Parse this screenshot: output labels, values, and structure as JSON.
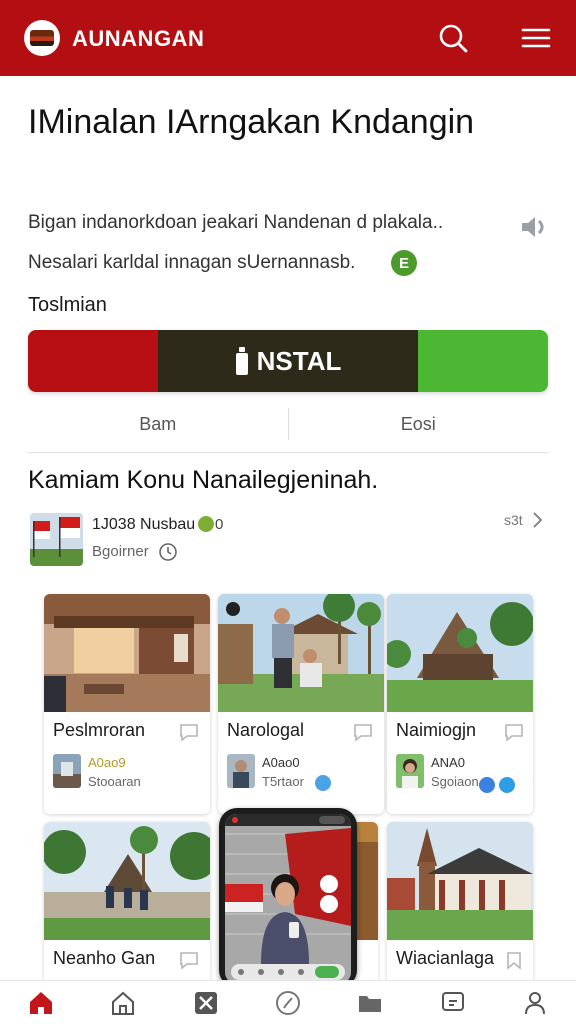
{
  "header": {
    "app_name": "AUNANGAN"
  },
  "hero": {
    "title": "IMinalan IArngakan Kndangin",
    "desc_line1": "Bigan indanorkdoan jeakari Nandenan d plakala..",
    "desc_line2": "Nesalari karldal innagan sUernannasb.",
    "badge": "E"
  },
  "install": {
    "section_label": "Toslmian",
    "button_label": "NSTAL",
    "sub_left": "Bam",
    "sub_right": "Eosi"
  },
  "collection": {
    "title": "Kamiam Konu Nanailegjeninah.",
    "featured": {
      "title": "1J038 Nusbau",
      "badge_text": "0",
      "subtitle": "Bgoirner",
      "see_all": "s3t"
    },
    "cards": [
      {
        "title": "Peslmroran",
        "meta1": "A0ao9",
        "meta2": "Stooaran"
      },
      {
        "title": "Narologal",
        "meta1": "A0ao0",
        "meta2": "T5rtaor"
      },
      {
        "title": "Naimiogjn",
        "meta1": "ANA0",
        "meta2": "Sgoiaon"
      },
      {
        "title": "Neanho Gan"
      },
      {
        "title": "Wiacianlaga"
      }
    ]
  },
  "colors": {
    "brand_red": "#b30f12",
    "install_red": "#b80f14",
    "install_dark": "#2e2a1a",
    "install_green": "#4cb733",
    "badge_green": "#4d9c2b"
  },
  "nav_icons": [
    "home-icon",
    "house-outline-icon",
    "cross-tile-icon",
    "compass-icon",
    "folder-icon",
    "chat-icon",
    "profile-icon"
  ]
}
